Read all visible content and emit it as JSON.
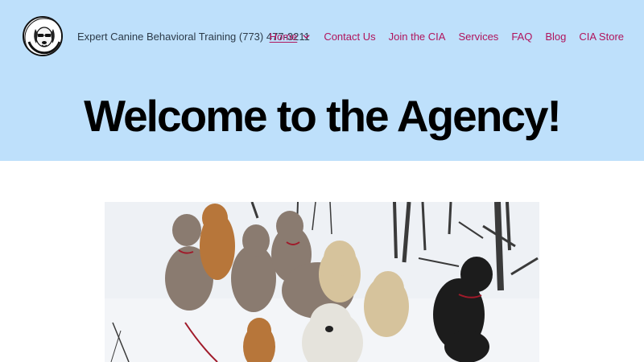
{
  "header": {
    "tagline": "Expert Canine Behavioral Training (773) 477-3211",
    "logo_icon": "dog-logo-icon",
    "background": "#bee0fb"
  },
  "nav": {
    "items": [
      {
        "label": "Home",
        "active": true,
        "has_dropdown": true
      },
      {
        "label": "Contact Us"
      },
      {
        "label": "Join the CIA"
      },
      {
        "label": "Services"
      },
      {
        "label": "FAQ"
      },
      {
        "label": "Blog"
      },
      {
        "label": "CIA Store"
      }
    ],
    "link_color": "#b0145c"
  },
  "hero": {
    "title": "Welcome to the Agency!"
  },
  "featured_image": {
    "icon": "dogs-in-snow-photo"
  }
}
